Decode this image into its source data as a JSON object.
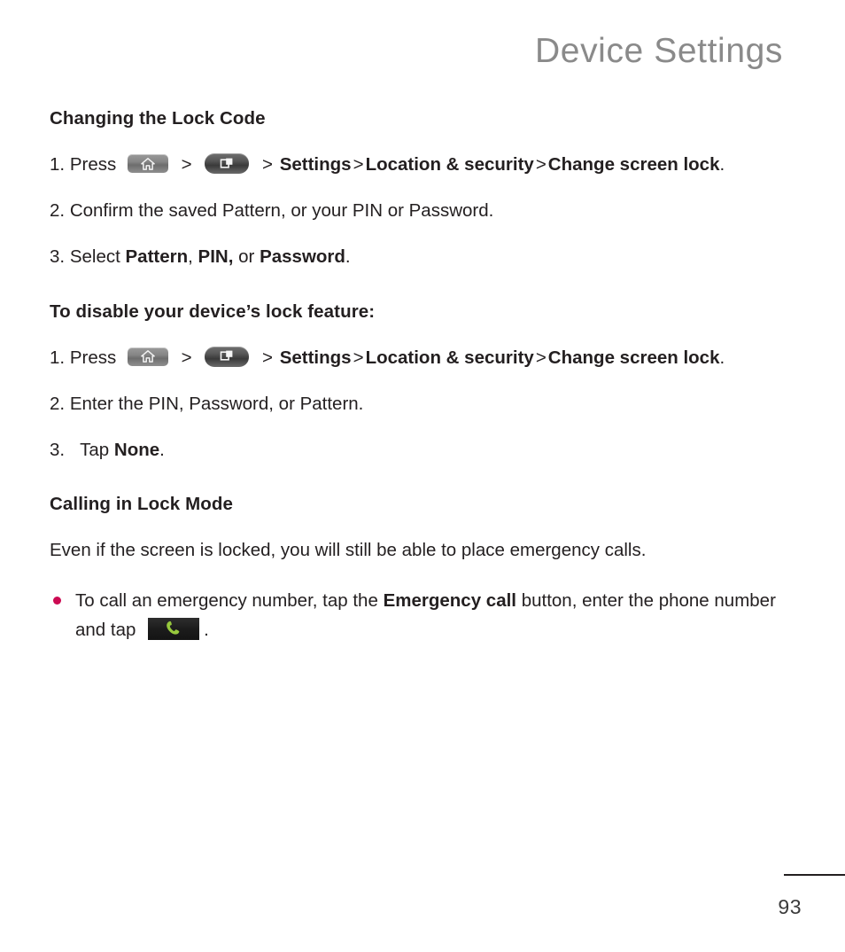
{
  "header": {
    "title": "Device Settings"
  },
  "sections": [
    {
      "heading": "Changing the Lock Code",
      "steps": [
        {
          "number": "1.",
          "prefix": "Press",
          "keys": [
            "home-key",
            "menu-key"
          ],
          "sep": ">",
          "breadcrumb": [
            "Settings",
            "Location & security",
            "Change screen lock"
          ],
          "end": "."
        },
        {
          "number": "2.",
          "text": "Confirm the saved Pattern, or your PIN or Password."
        },
        {
          "number": "3.",
          "pre": "Select",
          "bold1": "Pattern",
          "mid1": ",",
          "bold2": "PIN,",
          "mid2": "or",
          "bold3": "Password",
          "end": "."
        }
      ]
    },
    {
      "heading": "To disable your device’s lock feature:",
      "steps": [
        {
          "number": "1.",
          "prefix": "Press",
          "keys": [
            "home-key",
            "menu-key"
          ],
          "sep": ">",
          "breadcrumb": [
            "Settings",
            "Location & security",
            "Change screen lock"
          ],
          "end": "."
        },
        {
          "number": "2.",
          "text": "Enter the PIN, Password, or Pattern."
        },
        {
          "number": "3.",
          "pre": "Tap",
          "bold1": "None",
          "end": "."
        }
      ]
    },
    {
      "heading": "Calling in Lock Mode",
      "intro": "Even if the screen is locked, you will still be able to place emergency calls.",
      "bullet": {
        "part1": "To call an emergency number, tap the",
        "bold": "Emergency call",
        "part2": "button, enter the phone number and tap",
        "end": "."
      }
    }
  ],
  "footer": {
    "page_number": "93"
  },
  "colors": {
    "header_gray": "#8a8a8a",
    "text": "#231f20",
    "bullet": "#cc0a52",
    "call_icon_green": "#97c93d",
    "key_dark": "#3a3a3a",
    "key_gray": "#868686"
  }
}
